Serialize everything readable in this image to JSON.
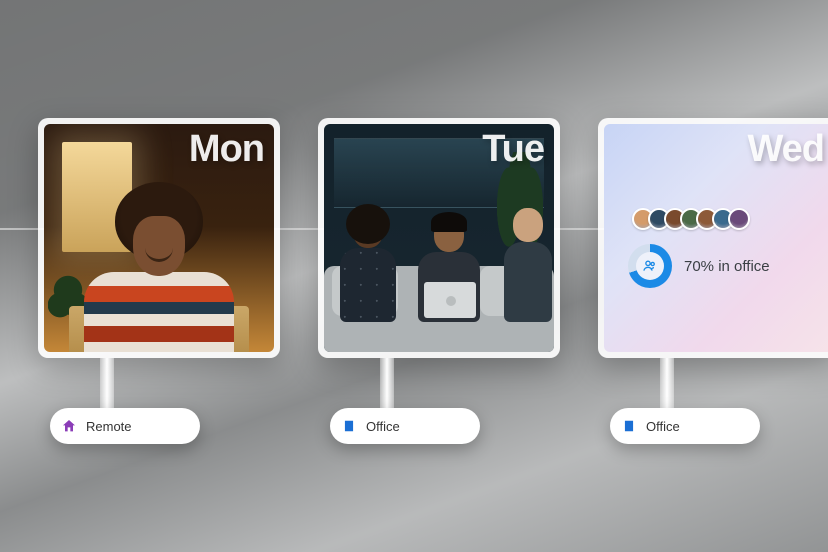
{
  "days": [
    {
      "short": "Mon",
      "location_label": "Remote",
      "location_icon": "home-icon",
      "accent": "#8b3db8"
    },
    {
      "short": "Tue",
      "location_label": "Office",
      "location_icon": "building-icon",
      "accent": "#1b6fd4"
    },
    {
      "short": "Wed",
      "location_label": "Office",
      "location_icon": "building-icon",
      "accent": "#1b6fd4",
      "stats": {
        "percent": 70,
        "text": "70% in office",
        "avatar_colors": [
          "#d49b6a",
          "#2e4a63",
          "#7a4a2d",
          "#4b6a46",
          "#8d5a38",
          "#3a6a8d",
          "#6a4a7a"
        ]
      }
    }
  ]
}
